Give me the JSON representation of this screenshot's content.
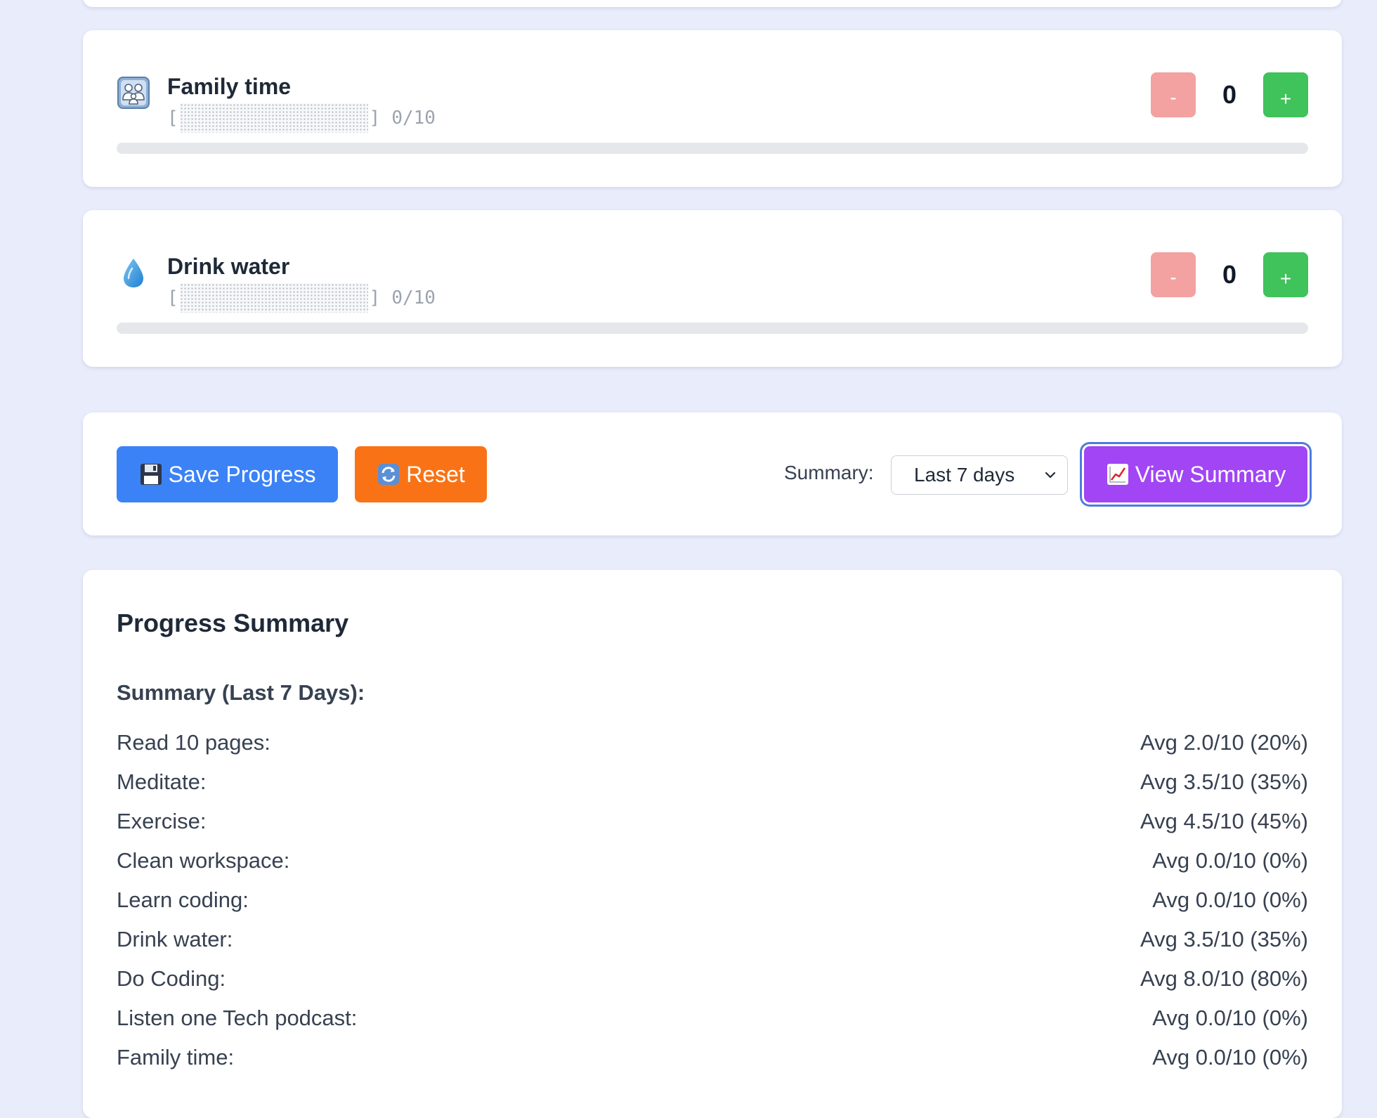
{
  "habits": [
    {
      "name": "Family time",
      "icon": "family-icon",
      "ascii_open": "[",
      "ascii_close": "]",
      "count_text": "0/10",
      "count": "0",
      "progress": 0,
      "minus_label": "-",
      "plus_label": "+"
    },
    {
      "name": "Drink water",
      "icon": "water-drop-icon",
      "ascii_open": "[",
      "ascii_close": "]",
      "count_text": "0/10",
      "count": "0",
      "progress": 0,
      "minus_label": "-",
      "plus_label": "+"
    }
  ],
  "actions": {
    "save_label": "Save Progress",
    "save_icon": "floppy-disk-icon",
    "reset_label": "Reset",
    "reset_icon": "refresh-icon",
    "summary_label": "Summary:",
    "summary_selected": "Last 7 days",
    "view_label": "View Summary",
    "view_icon": "chart-increasing-icon"
  },
  "summary": {
    "title": "Progress Summary",
    "subtitle": "Summary (Last 7 Days):",
    "rows": [
      {
        "label": "Read 10 pages:",
        "value": "Avg 2.0/10 (20%)"
      },
      {
        "label": "Meditate:",
        "value": "Avg 3.5/10 (35%)"
      },
      {
        "label": "Exercise:",
        "value": "Avg 4.5/10 (45%)"
      },
      {
        "label": "Clean workspace:",
        "value": "Avg 0.0/10 (0%)"
      },
      {
        "label": "Learn coding:",
        "value": "Avg 0.0/10 (0%)"
      },
      {
        "label": "Drink water:",
        "value": "Avg 3.5/10 (35%)"
      },
      {
        "label": "Do Coding:",
        "value": "Avg 8.0/10 (80%)"
      },
      {
        "label": "Listen one Tech podcast:",
        "value": "Avg 0.0/10 (0%)"
      },
      {
        "label": "Family time:",
        "value": "Avg 0.0/10 (0%)"
      }
    ]
  },
  "colors": {
    "background": "#e9edfb",
    "save_button": "#3b82f6",
    "reset_button": "#f97316",
    "view_button": "#a145f5",
    "minus_button": "#f3a1a1",
    "plus_button": "#3fc35a"
  }
}
